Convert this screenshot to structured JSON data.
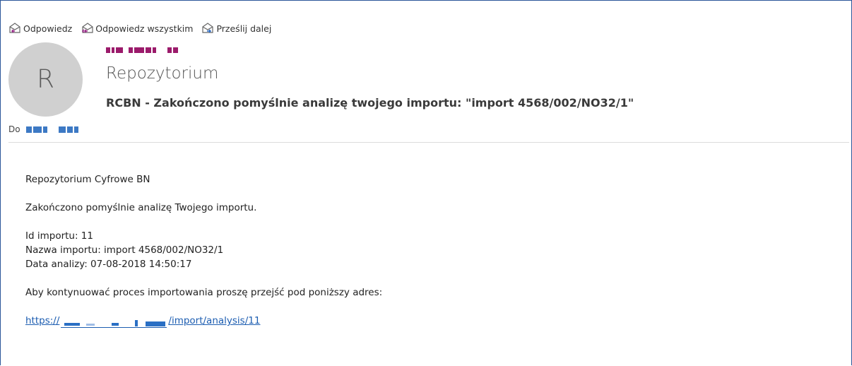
{
  "toolbar": {
    "reply_label": "Odpowiedz",
    "reply_all_label": "Odpowiedz wszystkim",
    "forward_label": "Prześlij dalej"
  },
  "message": {
    "avatar_initial": "R",
    "sender_name": "Repozytorium",
    "subject": "RCBN - Zakończono pomyślnie analizę twojego importu: \"import 4568/002/NO32/1\"",
    "to_label": "Do"
  },
  "body": {
    "greeting": "Repozytorium Cyfrowe BN",
    "intro": "Zakończono pomyślnie analizę Twojego importu.",
    "id_line": "Id importu: 11",
    "name_line": "Nazwa importu: import 4568/002/NO32/1",
    "date_line": "Data analizy: 07-08-2018 14:50:17",
    "instruction": "Aby kontynuować proces importowania proszę przejść pod poniższy adres:",
    "link_prefix": "https://",
    "link_suffix": "/import/analysis/11"
  }
}
